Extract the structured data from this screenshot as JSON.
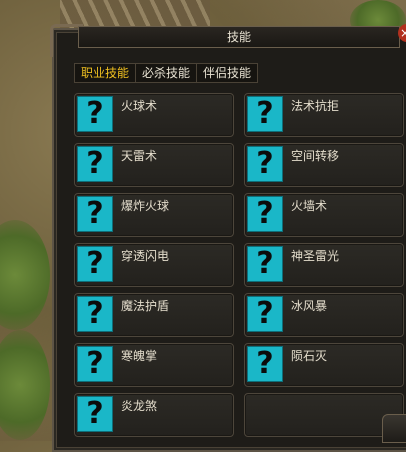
{
  "window": {
    "title": "技能",
    "close_glyph": "×"
  },
  "tabs": [
    {
      "label": "职业技能",
      "active": true
    },
    {
      "label": "必杀技能",
      "active": false
    },
    {
      "label": "伴侣技能",
      "active": false
    }
  ],
  "skills": [
    {
      "name": "火球术",
      "icon": "unknown-skill-icon",
      "glyph": "?"
    },
    {
      "name": "法术抗拒",
      "icon": "unknown-skill-icon",
      "glyph": "?"
    },
    {
      "name": "天雷术",
      "icon": "unknown-skill-icon",
      "glyph": "?"
    },
    {
      "name": "空间转移",
      "icon": "unknown-skill-icon",
      "glyph": "?"
    },
    {
      "name": "爆炸火球",
      "icon": "unknown-skill-icon",
      "glyph": "?"
    },
    {
      "name": "火墙术",
      "icon": "unknown-skill-icon",
      "glyph": "?"
    },
    {
      "name": "穿透闪电",
      "icon": "unknown-skill-icon",
      "glyph": "?"
    },
    {
      "name": "神圣雷光",
      "icon": "unknown-skill-icon",
      "glyph": "?"
    },
    {
      "name": "魔法护盾",
      "icon": "unknown-skill-icon",
      "glyph": "?"
    },
    {
      "name": "冰风暴",
      "icon": "unknown-skill-icon",
      "glyph": "?"
    },
    {
      "name": "寒魄掌",
      "icon": "unknown-skill-icon",
      "glyph": "?"
    },
    {
      "name": "陨石灭",
      "icon": "unknown-skill-icon",
      "glyph": "?"
    },
    {
      "name": "炎龙煞",
      "icon": "unknown-skill-icon",
      "glyph": "?"
    }
  ],
  "colors": {
    "icon_bg": "#1ab7c8",
    "active_tab": "#f0c020",
    "close_button": "#b2301e"
  }
}
